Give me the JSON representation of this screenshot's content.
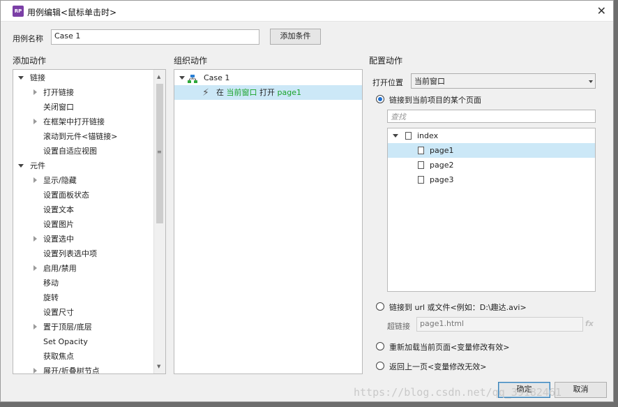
{
  "window": {
    "app_icon_text": "RP",
    "title": "用例编辑<鼠标单击时>"
  },
  "case_name": {
    "label": "用例名称",
    "value": "Case 1",
    "add_condition_label": "添加条件"
  },
  "add_actions": {
    "header": "添加动作",
    "tree": [
      {
        "label": "链接",
        "level": 0,
        "expander": "down"
      },
      {
        "label": "打开链接",
        "level": 1,
        "expander": "right"
      },
      {
        "label": "关闭窗口",
        "level": 1,
        "expander": "none"
      },
      {
        "label": "在框架中打开链接",
        "level": 1,
        "expander": "right"
      },
      {
        "label": "滚动到元件<锚链接>",
        "level": 1,
        "expander": "none"
      },
      {
        "label": "设置自适应视图",
        "level": 1,
        "expander": "none"
      },
      {
        "label": "元件",
        "level": 0,
        "expander": "down"
      },
      {
        "label": "显示/隐藏",
        "level": 1,
        "expander": "right"
      },
      {
        "label": "设置面板状态",
        "level": 1,
        "expander": "none"
      },
      {
        "label": "设置文本",
        "level": 1,
        "expander": "none"
      },
      {
        "label": "设置图片",
        "level": 1,
        "expander": "none"
      },
      {
        "label": "设置选中",
        "level": 1,
        "expander": "right"
      },
      {
        "label": "设置列表选中项",
        "level": 1,
        "expander": "none"
      },
      {
        "label": "启用/禁用",
        "level": 1,
        "expander": "right"
      },
      {
        "label": "移动",
        "level": 1,
        "expander": "none"
      },
      {
        "label": "旋转",
        "level": 1,
        "expander": "none"
      },
      {
        "label": "设置尺寸",
        "level": 1,
        "expander": "none"
      },
      {
        "label": "置于顶层/底层",
        "level": 1,
        "expander": "right"
      },
      {
        "label": "Set Opacity",
        "level": 1,
        "expander": "none"
      },
      {
        "label": "获取焦点",
        "level": 1,
        "expander": "none"
      },
      {
        "label": "展开/折叠树节点",
        "level": 1,
        "expander": "right"
      }
    ]
  },
  "organize_actions": {
    "header": "组织动作",
    "case_label": "Case 1",
    "action": {
      "prefix": "在",
      "target": "当前窗口",
      "verb": "打开",
      "page": "page1"
    }
  },
  "configure_actions": {
    "header": "配置动作",
    "open_in_label": "打开位置",
    "open_in_value": "当前窗口",
    "option_page": "链接到当前项目的某个页面",
    "search_placeholder": "查找",
    "pages_tree": {
      "root": "index",
      "children": [
        "page1",
        "page2",
        "page3"
      ],
      "selected": "page1"
    },
    "option_url": "链接到 url 或文件<例如：D:\\趣达.avi>",
    "hyperlink_label": "超链接",
    "hyperlink_value": "page1.html",
    "fx_label": "fx",
    "option_reload": "重新加载当前页面<变量修改有效>",
    "option_back": "返回上一页<变量修改无效>"
  },
  "footer": {
    "ok_label": "确定",
    "cancel_label": "取消"
  },
  "watermark": "https://blog.csdn.net/qq_39182461"
}
